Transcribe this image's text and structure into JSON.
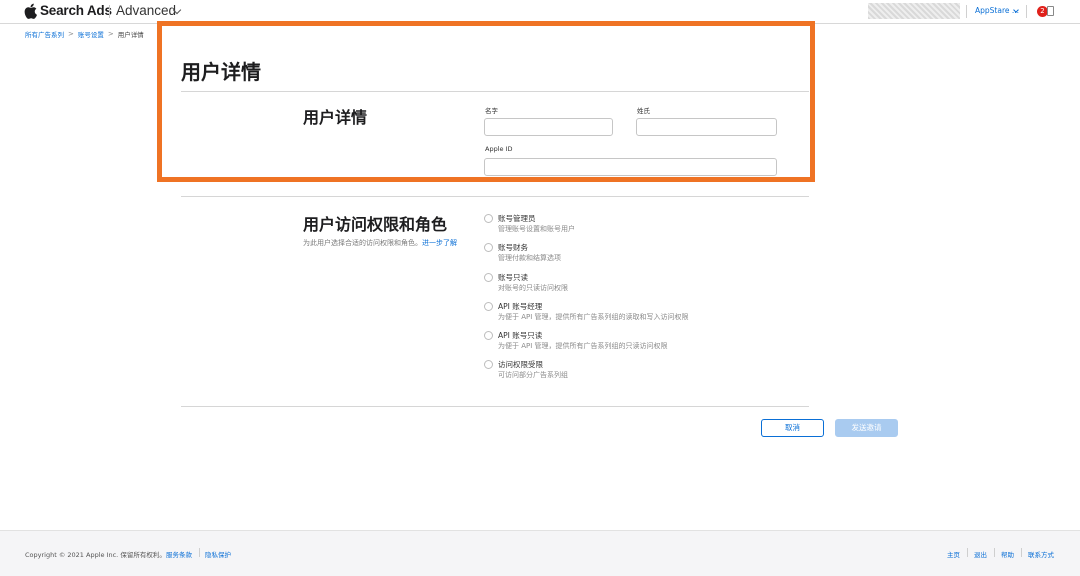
{
  "header": {
    "brand": "Search Ads",
    "mode": "Advanced",
    "org_name": "AppStare ...",
    "notification_count": "2"
  },
  "breadcrumb": {
    "items": [
      "所有广告系列",
      "账号设置"
    ],
    "current": "用户详情",
    "separator": ">"
  },
  "page_title": "用户详情",
  "user_details": {
    "section_title": "用户详情",
    "first_name_label": "名字",
    "last_name_label": "姓氏",
    "apple_id_label": "Apple ID",
    "first_name_value": "",
    "last_name_value": "",
    "apple_id_value": ""
  },
  "access": {
    "section_title": "用户访问权限和角色",
    "description": "为此用户选择合适的访问权限和角色。",
    "learn_more": "进一步了解",
    "roles": [
      {
        "title": "账号管理员",
        "desc": "管理账号设置和账号用户"
      },
      {
        "title": "账号财务",
        "desc": "管理付款和结算选项"
      },
      {
        "title": "账号只读",
        "desc": "对账号的只读访问权限"
      },
      {
        "title": "API 账号经理",
        "desc": "为便于 API 管理，提供所有广告系列组的读取和写入访问权限"
      },
      {
        "title": "API 账号只读",
        "desc": "为便于 API 管理，提供所有广告系列组的只读访问权限"
      },
      {
        "title": "访问权限受限",
        "desc": "可访问部分广告系列组"
      }
    ]
  },
  "actions": {
    "cancel": "取消",
    "send_invite": "发送邀请"
  },
  "footer": {
    "copyright": "Copyright © 2021 Apple Inc. 保留所有权利。",
    "terms": "服务条款",
    "privacy": "隐私保护",
    "home": "主页",
    "logout": "退出",
    "help": "帮助",
    "contact": "联系方式"
  },
  "colors": {
    "accent": "#0a6fd6",
    "highlight": "#ef7324",
    "badge": "#e0211b"
  }
}
